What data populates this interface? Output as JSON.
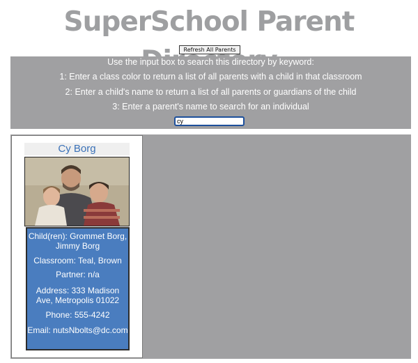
{
  "header": {
    "title": "SuperSchool Parent Directory"
  },
  "toolbar": {
    "refresh_label": "Refresh All Parents"
  },
  "search": {
    "instructions": [
      "Use the input box to search this directory by keyword:",
      "1: Enter a class color to return a list of all parents with a child in that classroom",
      "2: Enter a child's name to return a list of all parents or guardians of the child",
      "3: Enter a parent's name to search for an individual"
    ],
    "value": "cy"
  },
  "results": [
    {
      "name": "Cy Borg",
      "children": "Child(ren): Grommet Borg, Jimmy Borg",
      "classroom": "Classroom: Teal, Brown",
      "partner": "Partner: n/a",
      "address": "Address: 333 Madison Ave, Metropolis 01022",
      "phone": "Phone: 555-4242",
      "email": "Email: nutsNbolts@dc.com"
    }
  ]
}
